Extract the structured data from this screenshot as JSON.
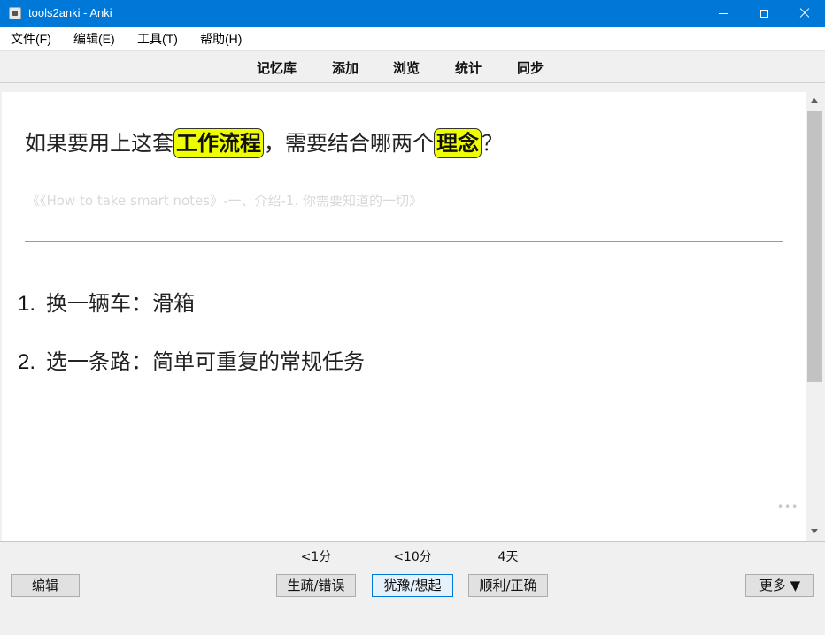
{
  "window": {
    "title": "tools2anki - Anki"
  },
  "menu": {
    "items": [
      "文件(F)",
      "编辑(E)",
      "工具(T)",
      "帮助(H)"
    ]
  },
  "toolbar": {
    "links": [
      "记忆库",
      "添加",
      "浏览",
      "统计",
      "同步"
    ]
  },
  "card": {
    "question_before": "如果要用上这套",
    "cloze_1": "工作流程",
    "question_middle": "，需要结合哪两个",
    "cloze_2": "理念",
    "question_after": "？",
    "source": "《《How to take smart notes》-一、介绍-1. 你需要知道的一切》",
    "answers": [
      {
        "num": "1.",
        "text": "换一辆车：滑箱"
      },
      {
        "num": "2.",
        "text": "选一条路：简单可重复的常规任务"
      }
    ],
    "cloze_color": "#f0ff00"
  },
  "bottom": {
    "edit_label": "编辑",
    "more_label": "更多 ▼",
    "answer_buttons": [
      {
        "label": "生疏/错误",
        "interval": "<1分"
      },
      {
        "label": "犹豫/想起",
        "interval": "<10分"
      },
      {
        "label": "顺利/正确",
        "interval": "4天"
      }
    ]
  },
  "colors": {
    "titlebar": "#0078d7",
    "focus_border": "#0078d7"
  }
}
